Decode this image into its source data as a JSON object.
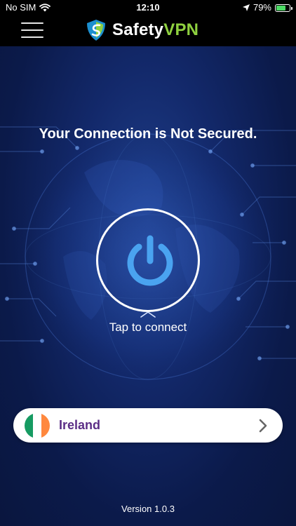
{
  "status_bar": {
    "carrier": "No SIM",
    "time": "12:10",
    "battery_percent": "79%",
    "battery_level": 0.79,
    "wifi_icon": "wifi-icon",
    "location_icon": "location-arrow-icon"
  },
  "header": {
    "brand_part1": "Safety",
    "brand_part2": "VPN",
    "menu_icon": "hamburger-menu-icon",
    "logo_icon": "safetyvpn-shield-logo"
  },
  "main": {
    "connection_status": "Your Connection is Not Secured.",
    "power_icon": "power-icon",
    "tap_label": "Tap to connect"
  },
  "server": {
    "country": "Ireland",
    "flag_colors": [
      "#169b62",
      "#ffffff",
      "#ff883e"
    ],
    "arrow_icon": "chevron-right-icon"
  },
  "footer": {
    "version": "Version 1.0.3"
  },
  "colors": {
    "accent": "#8fd13f",
    "power": "#4aa3f0",
    "country_text": "#5b2d86",
    "background": "#13296b"
  }
}
